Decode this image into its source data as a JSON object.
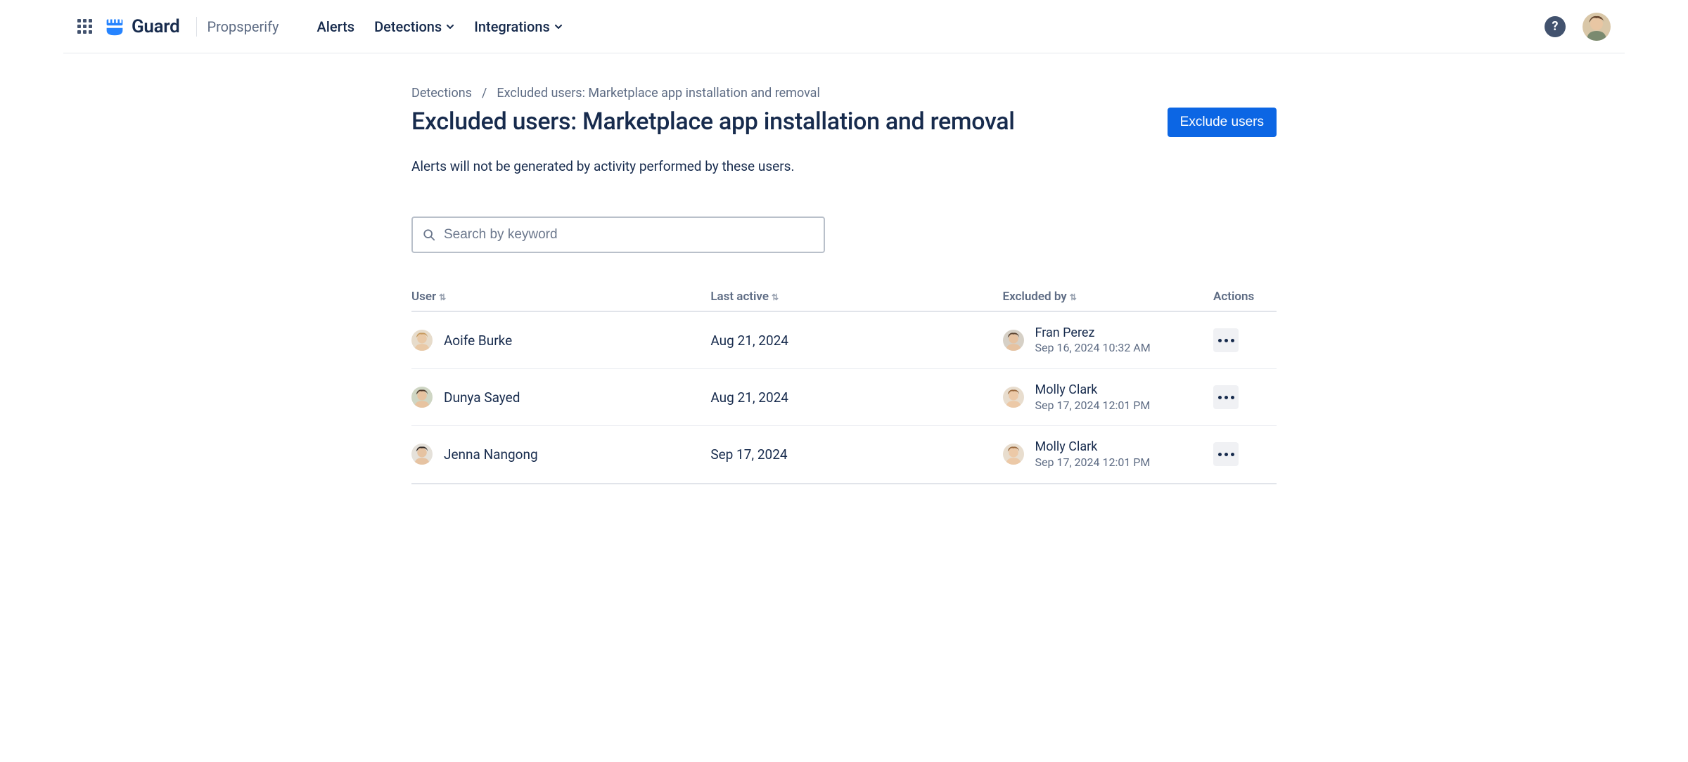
{
  "header": {
    "product_name": "Guard",
    "org_name": "Propsperify",
    "nav": {
      "alerts": "Alerts",
      "detections": "Detections",
      "integrations": "Integrations"
    }
  },
  "breadcrumb": {
    "root": "Detections",
    "current": "Excluded users: Marketplace app installation and removal"
  },
  "page": {
    "title": "Excluded users: Marketplace app installation and removal",
    "primary_action": "Exclude users",
    "description": "Alerts will not be generated by activity performed by these users."
  },
  "search": {
    "placeholder": "Search by keyword",
    "value": ""
  },
  "table": {
    "headers": {
      "user": "User",
      "last_active": "Last active",
      "excluded_by": "Excluded by",
      "actions": "Actions"
    },
    "rows": [
      {
        "user": "Aoife Burke",
        "last_active": "Aug 21, 2024",
        "excluded_by_name": "Fran Perez",
        "excluded_by_ts": "Sep 16, 2024 10:32 AM"
      },
      {
        "user": "Dunya Sayed",
        "last_active": "Aug 21, 2024",
        "excluded_by_name": "Molly Clark",
        "excluded_by_ts": "Sep 17, 2024 12:01 PM"
      },
      {
        "user": "Jenna Nangong",
        "last_active": "Sep 17, 2024",
        "excluded_by_name": "Molly Clark",
        "excluded_by_ts": "Sep 17, 2024 12:01 PM"
      }
    ]
  },
  "avatar_colors": {
    "topbar": {
      "bg": "#d9c7a8",
      "skin": "#e8c6a3",
      "hair": "#6a4a32"
    },
    "rows": [
      {
        "user": {
          "bg": "#e7dccb",
          "skin": "#e9c9a6",
          "hair": "#c79a5e"
        },
        "excl": {
          "bg": "#d6d0c6",
          "skin": "#e6c2a0",
          "hair": "#5b4330"
        }
      },
      {
        "user": {
          "bg": "#cfd6c4",
          "skin": "#e7c3a0",
          "hair": "#4e3a2b"
        },
        "excl": {
          "bg": "#e8ddce",
          "skin": "#ecc9a7",
          "hair": "#9a6a3f"
        }
      },
      {
        "user": {
          "bg": "#e5e1da",
          "skin": "#e6c3a2",
          "hair": "#2f2824"
        },
        "excl": {
          "bg": "#e8ddce",
          "skin": "#ecc9a7",
          "hair": "#9a6a3f"
        }
      }
    ]
  }
}
